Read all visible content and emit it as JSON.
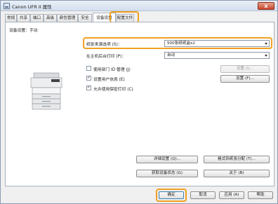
{
  "window": {
    "title": "Canon UFR II 属性",
    "close_glyph": "x"
  },
  "tabs": [
    {
      "label": "常规"
    },
    {
      "label": "共享"
    },
    {
      "label": "端口"
    },
    {
      "label": "高级"
    },
    {
      "label": "颜色管理"
    },
    {
      "label": "安全"
    },
    {
      "label": "设备设置"
    },
    {
      "label": "配置文件"
    }
  ],
  "active_tab_index": 6,
  "panel": {
    "device_settings_label": "设备设置：手动",
    "paper_source_option": {
      "label": "纸张来源选项 (S)：",
      "value": "500张纸纸盒x2"
    },
    "host_spooling": {
      "label": "在主机后台打印 (P)：",
      "value": "自动"
    },
    "department_id": {
      "label": "使用部门 ID 管理 (J)",
      "checked": false,
      "settings_label": "设置 (I)..."
    },
    "user_info": {
      "label": "设置用户信息 (E)",
      "checked": true,
      "settings_label": "设置 (F)..."
    },
    "secure_print": {
      "label": "允许使用保密打印 (C)",
      "checked": true
    },
    "details_button": "详细设置 (Q)...",
    "format_button": "格式到纸张分配 (T)...",
    "get_device_status_button": "获取设备状态 (G)",
    "about_button": "关于 (B)"
  },
  "footer": {
    "ok": "确定",
    "cancel": "取消",
    "apply": "应用 (A)",
    "help": "帮助"
  },
  "colors": {
    "highlight": "#f0a020"
  }
}
